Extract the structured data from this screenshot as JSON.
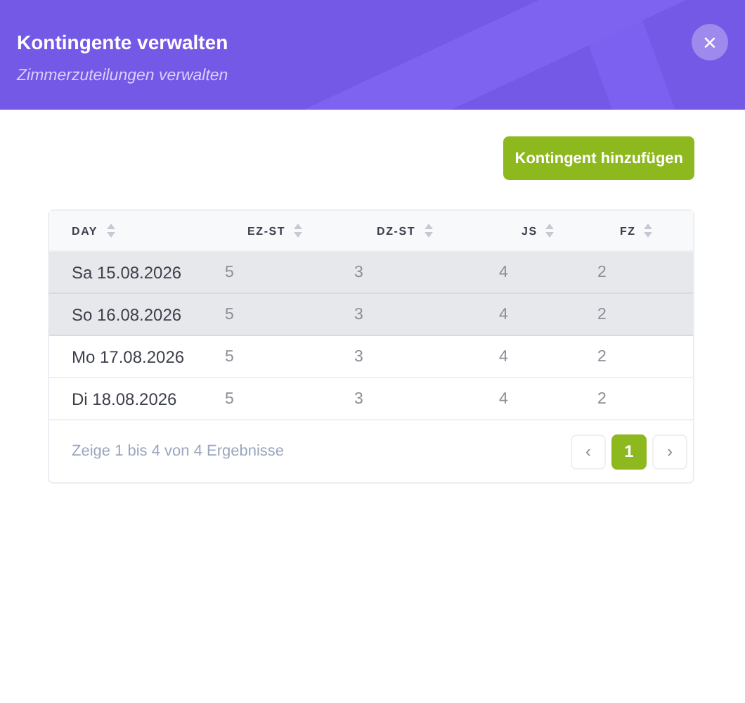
{
  "header": {
    "title": "Kontingente verwalten",
    "subtitle": "Zimmerzuteilungen verwalten",
    "close": "×"
  },
  "add_button": "Kontingent hinzufügen",
  "table": {
    "columns": [
      "DAY",
      "EZ-ST",
      "DZ-ST",
      "JS",
      "FZ"
    ],
    "rows": [
      {
        "cells": [
          "Sa 15.08.2026",
          "5",
          "3",
          "4",
          "2"
        ],
        "highlighted": true
      },
      {
        "cells": [
          "So 16.08.2026",
          "5",
          "3",
          "4",
          "2"
        ],
        "highlighted": true
      },
      {
        "cells": [
          "Mo 17.08.2026",
          "5",
          "3",
          "4",
          "2"
        ],
        "highlighted": false
      },
      {
        "cells": [
          "Di 18.08.2026",
          "5",
          "3",
          "4",
          "2"
        ],
        "highlighted": false
      }
    ]
  },
  "pagination": {
    "summary": "Zeige 1 bis 4 von 4 Ergebnisse",
    "prev": "‹",
    "next": "›",
    "pages": [
      {
        "label": "1",
        "selected": true
      }
    ]
  }
}
